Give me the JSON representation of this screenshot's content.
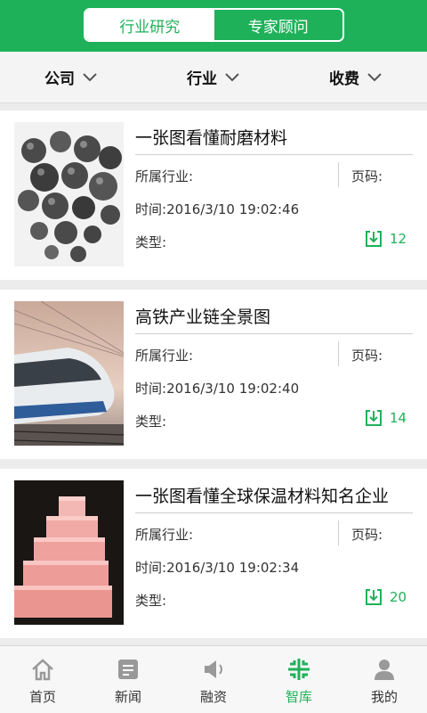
{
  "header": {
    "tabs": [
      {
        "label": "行业研究",
        "active": true
      },
      {
        "label": "专家顾问",
        "active": false
      }
    ],
    "accent": "#1fb15a"
  },
  "filters": [
    {
      "label": "公司"
    },
    {
      "label": "行业"
    },
    {
      "label": "收费"
    }
  ],
  "labels": {
    "industry": "所属行业:",
    "page": "页码:",
    "time_prefix": "时间:",
    "type": "类型:"
  },
  "items": [
    {
      "title": "一张图看懂耐磨材料",
      "time": "2016/3/10 19:02:46",
      "downloads": "12",
      "image": "grinding-balls-image"
    },
    {
      "title": "高铁产业链全景图",
      "time": "2016/3/10 19:02:40",
      "downloads": "14",
      "image": "bullet-train-image"
    },
    {
      "title": "一张图看懂全球保温材料知名企业",
      "time": "2016/3/10 19:02:34",
      "downloads": "20",
      "image": "insulation-blocks-image"
    }
  ],
  "nav": [
    {
      "label": "首页",
      "icon": "home-icon",
      "active": false
    },
    {
      "label": "新闻",
      "icon": "news-icon",
      "active": false
    },
    {
      "label": "融资",
      "icon": "speaker-icon",
      "active": false
    },
    {
      "label": "智库",
      "icon": "think-tank-icon",
      "active": true
    },
    {
      "label": "我的",
      "icon": "user-icon",
      "active": false
    }
  ]
}
